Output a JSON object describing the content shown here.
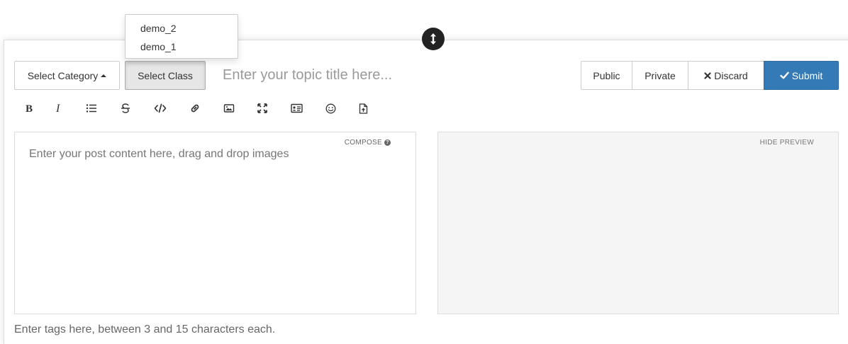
{
  "composer": {
    "category_label": "Select Category",
    "class_label": "Select Class",
    "title_placeholder": "Enter your topic title here...",
    "public_label": "Public",
    "private_label": "Private",
    "discard_label": "Discard",
    "submit_label": "Submit",
    "compose_label": "COMPOSE",
    "hide_preview_label": "HIDE PREVIEW",
    "content_placeholder": "Enter your post content here, drag and drop images",
    "tags_placeholder": "Enter tags here, between 3 and 15 characters each."
  },
  "class_dropdown": {
    "options": [
      "demo_2",
      "demo_1"
    ]
  },
  "toolbar": {
    "icons": [
      "bold-icon",
      "italic-icon",
      "list-icon",
      "strikethrough-icon",
      "code-icon",
      "link-icon",
      "image-icon",
      "fullscreen-icon",
      "id-card-icon",
      "smile-icon",
      "file-upload-icon"
    ]
  },
  "colors": {
    "submit": "#337ab7",
    "preview_bg": "#f5f5f5"
  }
}
